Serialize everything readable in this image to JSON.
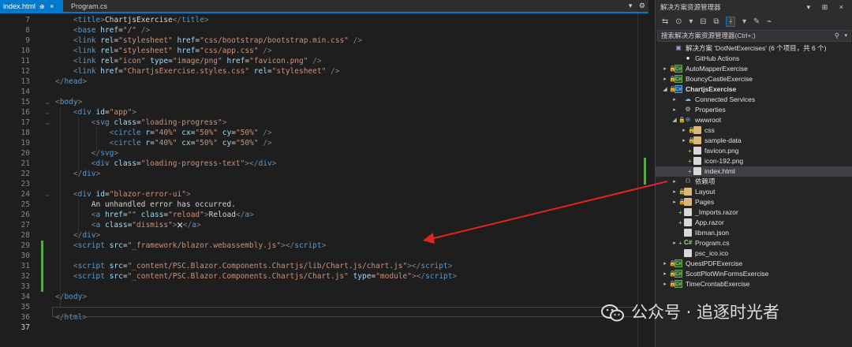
{
  "tabs": {
    "active_label": "index.html",
    "active_pin": "⊕",
    "active_close": "×",
    "second_label": "Program.cs",
    "right_icons": [
      "▾",
      "⚙"
    ]
  },
  "editor": {
    "line_numbers": [
      "7",
      "8",
      "9",
      "10",
      "11",
      "12",
      "13",
      "14",
      "15",
      "16",
      "17",
      "18",
      "19",
      "20",
      "21",
      "22",
      "23",
      "24",
      "25",
      "26",
      "27",
      "28",
      "29",
      "30",
      "31",
      "32",
      "33",
      "34",
      "35",
      "36",
      "37"
    ],
    "current_line": "37",
    "code": {
      "l7": {
        "t": "title",
        "text": "ChartjsExercise"
      },
      "l8": {
        "tag": "base",
        "a1": "href",
        "v1": "\"/\"",
        "end": " />"
      },
      "l9": {
        "tag": "link",
        "a1": "rel",
        "v1": "\"stylesheet\"",
        "a2": "href",
        "v2": "\"css/bootstrap/bootstrap.min.css\"",
        "end": " />"
      },
      "l10": {
        "tag": "link",
        "a1": "rel",
        "v1": "\"stylesheet\"",
        "a2": "href",
        "v2": "\"css/app.css\"",
        "end": " />"
      },
      "l11": {
        "tag": "link",
        "a1": "rel",
        "v1": "\"icon\"",
        "a2": "type",
        "v2": "\"image/png\"",
        "a3": "href",
        "v3": "\"favicon.png\"",
        "end": " />"
      },
      "l12": {
        "tag": "link",
        "a1": "href",
        "v1": "\"ChartjsExercise.styles.css\"",
        "a2": "rel",
        "v2": "\"stylesheet\"",
        "end": " />"
      },
      "l13": {
        "close": "head"
      },
      "l15": {
        "open": "body"
      },
      "l16": {
        "tag": "div",
        "a1": "id",
        "v1": "\"app\""
      },
      "l17": {
        "tag": "svg",
        "a1": "class",
        "v1": "\"loading-progress\""
      },
      "l18": {
        "tag": "circle",
        "a1": "r",
        "v1": "\"40%\"",
        "a2": "cx",
        "v2": "\"50%\"",
        "a3": "cy",
        "v3": "\"50%\"",
        "end": " />"
      },
      "l19": {
        "tag": "circle",
        "a1": "r",
        "v1": "\"40%\"",
        "a2": "cx",
        "v2": "\"50%\"",
        "a3": "cy",
        "v3": "\"50%\"",
        "end": " />"
      },
      "l20": {
        "close": "svg"
      },
      "l21": {
        "tag": "div",
        "a1": "class",
        "v1": "\"loading-progress-text\"",
        "close": "div"
      },
      "l22": {
        "close": "div"
      },
      "l24": {
        "tag": "div",
        "a1": "id",
        "v1": "\"blazor-error-ui\""
      },
      "l25": {
        "text": "An unhandled error has occurred."
      },
      "l26": {
        "tag": "a",
        "a1": "href",
        "v1": "\"\"",
        "a2": "class",
        "v2": "\"reload\"",
        "text": "Reload",
        "close": "a"
      },
      "l27": {
        "tag": "a",
        "a1": "class",
        "v1": "\"dismiss\"",
        "text": "🗙",
        "close": "a"
      },
      "l28": {
        "close": "div"
      },
      "l29": {
        "tag": "script",
        "a1": "src",
        "v1": "\"_framework/blazor.webassembly.js\"",
        "close": "script"
      },
      "l31": {
        "tag": "script",
        "a1": "src",
        "v1": "\"_content/PSC.Blazor.Components.Chartjs/lib/Chart.js/chart.js\"",
        "close": "script"
      },
      "l32": {
        "tag": "script",
        "a1": "src",
        "v1": "\"_content/PSC.Blazor.Components.Chartjs/Chart.js\"",
        "a2": "type",
        "v2": "\"module\"",
        "close": "script"
      },
      "l34": {
        "close": "body"
      },
      "l36": {
        "close": "html"
      }
    }
  },
  "explorer": {
    "title": "解决方案资源管理器",
    "title_controls": "▾ ⊞ ×",
    "toolbar_icons": [
      "⇆",
      "⊙",
      "▾",
      "⊟",
      "⧉",
      "⍭",
      "▾",
      "✎",
      "⌁"
    ],
    "search_placeholder": "搜索解决方案资源管理器(Ctrl+;)",
    "search_icon": "⚲",
    "search_dropdown": "▾",
    "items": [
      {
        "label": "解决方案 'DotNetExercises' (6 个项目，共 6 个)",
        "icon": "solution-icon",
        "glyph": "▣"
      },
      {
        "label": "GitHub Actions",
        "icon": "github-icon",
        "glyph": "●"
      },
      {
        "label": "AutoMapperExercise",
        "icon": "project-icon",
        "glyph": "C#"
      },
      {
        "label": "BouncyCastleExercise",
        "icon": "project-icon",
        "glyph": "C#"
      },
      {
        "label": "ChartjsExercise",
        "icon": "project-icon",
        "glyph": "C#"
      },
      {
        "label": "Connected Services",
        "icon": "connected-services-icon",
        "glyph": "☁"
      },
      {
        "label": "Properties",
        "icon": "properties-icon",
        "glyph": "⚙"
      },
      {
        "label": "wwwroot",
        "icon": "globe-icon",
        "glyph": "⊕"
      },
      {
        "label": "css",
        "icon": "folder-icon",
        "glyph": ""
      },
      {
        "label": "sample-data",
        "icon": "folder-icon",
        "glyph": ""
      },
      {
        "label": "favicon.png",
        "icon": "image-file-icon",
        "glyph": ""
      },
      {
        "label": "icon-192.png",
        "icon": "image-file-icon",
        "glyph": ""
      },
      {
        "label": "index.html",
        "icon": "html-file-icon",
        "glyph": ""
      },
      {
        "label": "依赖项",
        "icon": "dependencies-icon",
        "glyph": "⚇"
      },
      {
        "label": "Layout",
        "icon": "folder-icon",
        "glyph": ""
      },
      {
        "label": "Pages",
        "icon": "folder-icon",
        "glyph": ""
      },
      {
        "label": "_Imports.razor",
        "icon": "razor-file-icon",
        "glyph": ""
      },
      {
        "label": "App.razor",
        "icon": "razor-file-icon",
        "glyph": ""
      },
      {
        "label": "libman.json",
        "icon": "json-file-icon",
        "glyph": ""
      },
      {
        "label": "Program.cs",
        "icon": "csharp-file-icon",
        "glyph": "C#"
      },
      {
        "label": "psc_ico.ico",
        "icon": "ico-file-icon",
        "glyph": ""
      },
      {
        "label": "QuestPDFExercise",
        "icon": "project-icon",
        "glyph": "C#"
      },
      {
        "label": "ScottPlotWinFormsExercise",
        "icon": "project-icon",
        "glyph": "C#"
      },
      {
        "label": "TimeCrontabExercise",
        "icon": "project-icon",
        "glyph": "C#"
      }
    ]
  },
  "watermark": {
    "text": "公众号 · 追逐时光者"
  },
  "colors": {
    "accent": "#007acc",
    "arrow": "#e02424",
    "change_bar": "#57a64a"
  }
}
